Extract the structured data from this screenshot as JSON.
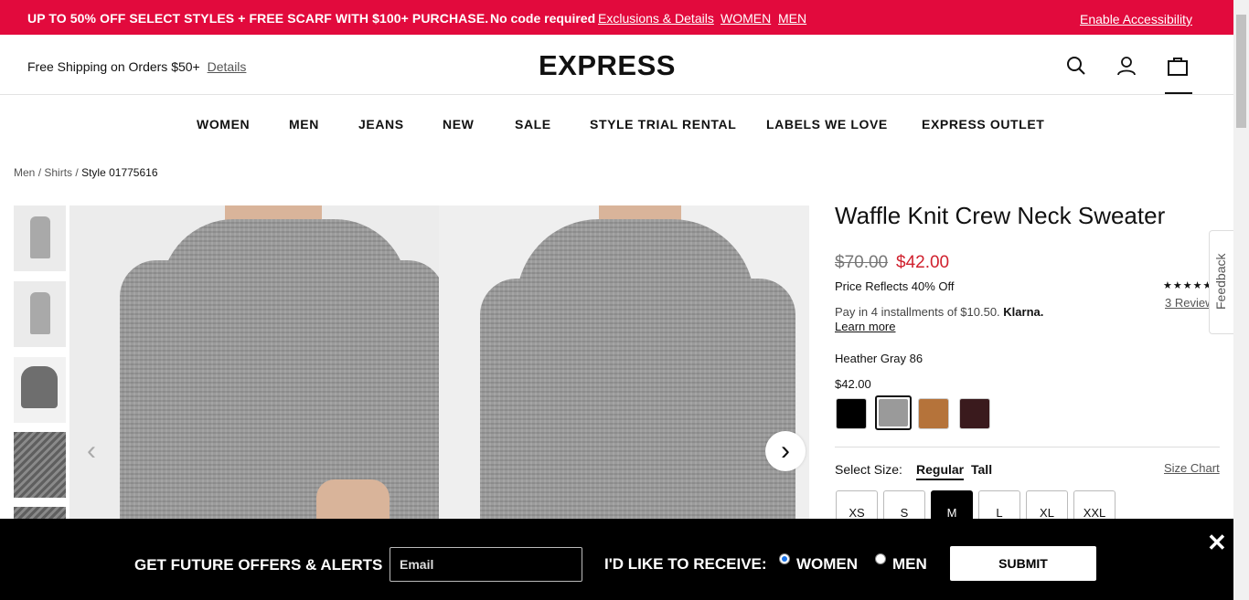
{
  "promo": {
    "text": "UP TO 50% OFF SELECT STYLES + FREE SCARF WITH $100+ PURCHASE.",
    "no_code": "No code required",
    "links": [
      "Exclusions & Details",
      "WOMEN",
      "MEN"
    ],
    "accessibility": "Enable Accessibility",
    "color": "#e20a3d"
  },
  "header": {
    "shipping": "Free Shipping on Orders $50+",
    "shipping_link": "Details",
    "logo": "EXPRESS",
    "icons": [
      "search-icon",
      "account-icon",
      "shopping-bag-icon"
    ]
  },
  "nav": {
    "items": [
      "WOMEN",
      "MEN",
      "JEANS",
      "NEW",
      "SALE",
      "STYLE TRIAL RENTAL",
      "LABELS WE LOVE",
      "EXPRESS OUTLET"
    ]
  },
  "breadcrumb": {
    "items": [
      "Men",
      "Shirts"
    ],
    "current": "Style 01775616",
    "sep": "/"
  },
  "product": {
    "title": "Waffle Knit Crew Neck Sweater",
    "original_price": "$70.00",
    "sale_price": "$42.00",
    "price_note": "Price Reflects 40% Off",
    "installments": "Pay in 4 installments of $10.50.",
    "klarna": "Klarna.",
    "learn_more": "Learn more",
    "rating_stars": "★★★★★",
    "reviews": "3 Reviews",
    "color_name": "Heather Gray 86",
    "color_price": "$42.00",
    "swatches": [
      {
        "name": "black",
        "hex": "#000000"
      },
      {
        "name": "heather gray",
        "hex": "#9a9a9a",
        "selected": true
      },
      {
        "name": "tan",
        "hex": "#b5733a"
      },
      {
        "name": "burgundy",
        "hex": "#3a1a1d"
      }
    ],
    "size_label": "Select Size:",
    "fits": [
      "Regular",
      "Tall"
    ],
    "selected_fit": "Regular",
    "size_chart": "Size Chart",
    "sizes": [
      "XS",
      "S",
      "M",
      "L",
      "XL",
      "XXL"
    ],
    "selected_size": "M"
  },
  "feedback": "Feedback",
  "signup": {
    "label": "GET FUTURE OFFERS & ALERTS",
    "email_placeholder": "Email",
    "receive_label": "I'D LIKE TO RECEIVE:",
    "options": [
      "WOMEN",
      "MEN"
    ],
    "selected_option": "WOMEN",
    "submit": "SUBMIT",
    "close": "✕"
  }
}
